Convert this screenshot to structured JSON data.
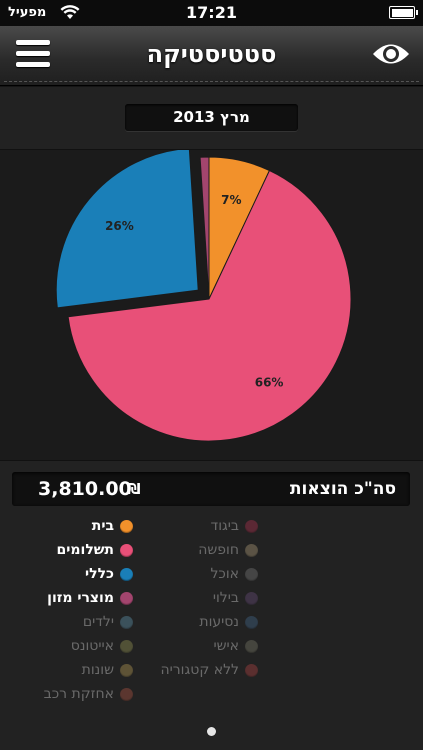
{
  "status_bar": {
    "carrier": "מפעיל",
    "time": "17:21"
  },
  "nav": {
    "title": "סטטיסטיקה"
  },
  "month": "מרץ 2013",
  "chart_data": {
    "type": "pie",
    "slices": [
      {
        "label": "בית",
        "value": 7,
        "color": "#f2912b",
        "display": "7%"
      },
      {
        "label": "תשלומים",
        "value": 66,
        "color": "#e85078",
        "display": "66%"
      },
      {
        "label": "כללי",
        "value": 26,
        "color": "#1a7fb8",
        "display": "26%",
        "exploded": true
      },
      {
        "label": "מוצרי מזון",
        "value": 1,
        "color": "#a3456e",
        "display": ""
      }
    ]
  },
  "total": {
    "label": "סה\"כ הוצאות",
    "value": "3,810.00",
    "currency": "₪"
  },
  "legend": {
    "right": [
      {
        "label": "בית",
        "color": "#f2912b",
        "active": true
      },
      {
        "label": "תשלומים",
        "color": "#e85078",
        "active": true
      },
      {
        "label": "כללי",
        "color": "#1a7fb8",
        "active": true
      },
      {
        "label": "מוצרי מזון",
        "color": "#a3456e",
        "active": true
      },
      {
        "label": "ילדים",
        "color": "#5a8aa0",
        "active": false
      },
      {
        "label": "אייטונס",
        "color": "#8a8a50",
        "active": false
      },
      {
        "label": "שונות",
        "color": "#a89050",
        "active": false
      },
      {
        "label": "אחזקת רכב",
        "color": "#a05040",
        "active": false
      }
    ],
    "left": [
      {
        "label": "ביגוד",
        "color": "#a0304a",
        "active": false
      },
      {
        "label": "חופשה",
        "color": "#a09070",
        "active": false
      },
      {
        "label": "אוכל",
        "color": "#707070",
        "active": false
      },
      {
        "label": "בילוי",
        "color": "#604870",
        "active": false
      },
      {
        "label": "נסיעות",
        "color": "#406080",
        "active": false
      },
      {
        "label": "אישי",
        "color": "#707060",
        "active": false
      },
      {
        "label": "ללא קטגוריה",
        "color": "#a04040",
        "active": false
      }
    ]
  }
}
